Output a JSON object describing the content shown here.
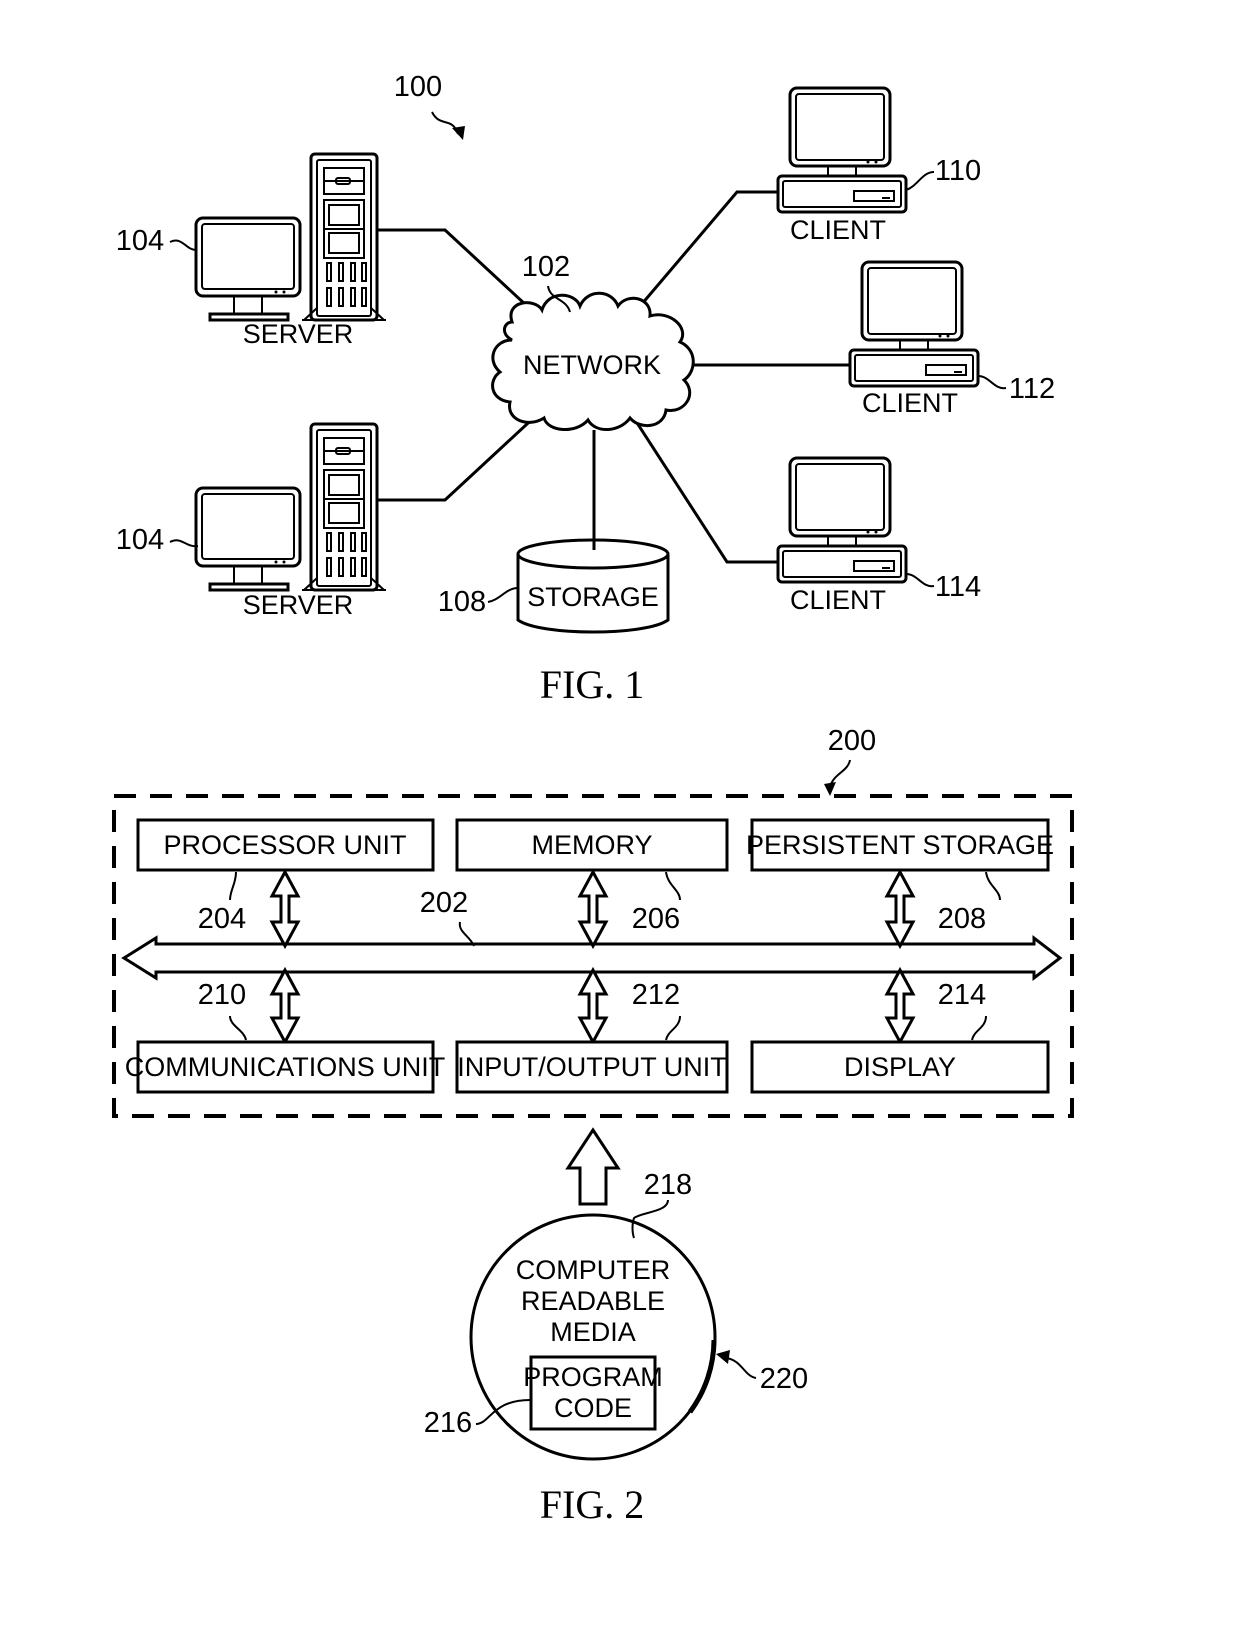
{
  "figure1": {
    "caption": "FIG. 1",
    "system_ref": "100",
    "network": {
      "label": "NETWORK",
      "ref": "102"
    },
    "servers": [
      {
        "label": "SERVER",
        "ref": "104"
      },
      {
        "label": "SERVER",
        "ref": "104"
      }
    ],
    "storage": {
      "label": "STORAGE",
      "ref": "108"
    },
    "clients": [
      {
        "label": "CLIENT",
        "ref": "110"
      },
      {
        "label": "CLIENT",
        "ref": "112"
      },
      {
        "label": "CLIENT",
        "ref": "114"
      }
    ]
  },
  "figure2": {
    "caption": "FIG. 2",
    "system_ref": "200",
    "bus_ref": "202",
    "top_units": [
      {
        "label": "PROCESSOR UNIT",
        "ref": "204"
      },
      {
        "label": "MEMORY",
        "ref": "206"
      },
      {
        "label": "PERSISTENT STORAGE",
        "ref": "208"
      }
    ],
    "bottom_units": [
      {
        "label": "COMMUNICATIONS UNIT",
        "ref": "210"
      },
      {
        "label": "INPUT/OUTPUT UNIT",
        "ref": "212"
      },
      {
        "label": "DISPLAY",
        "ref": "214"
      }
    ],
    "media": {
      "lines": [
        "COMPUTER",
        "READABLE",
        "MEDIA"
      ],
      "ref": "218",
      "product_ref": "220",
      "program_code": {
        "lines": [
          "PROGRAM",
          "CODE"
        ],
        "ref": "216"
      }
    }
  }
}
